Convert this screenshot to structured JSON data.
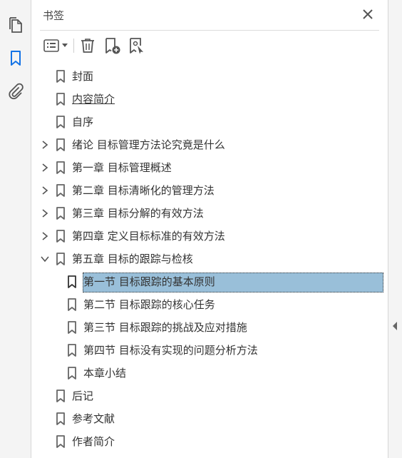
{
  "panel": {
    "title": "书签"
  },
  "toolbar": {
    "options": "options-menu",
    "delete": "delete",
    "new_bookmark": "new-bookmark",
    "new_from_structure": "new-from-structure"
  },
  "bookmarks": [
    {
      "label": "封面",
      "level": 0,
      "expandable": false
    },
    {
      "label": "内容简介",
      "level": 0,
      "expandable": false,
      "underlined": true
    },
    {
      "label": "自序",
      "level": 0,
      "expandable": false
    },
    {
      "label": "绪论 目标管理方法论究竟是什么",
      "level": 0,
      "expandable": true,
      "expanded": false
    },
    {
      "label": "第一章 目标管理概述",
      "level": 0,
      "expandable": true,
      "expanded": false
    },
    {
      "label": "第二章 目标清晰化的管理方法",
      "level": 0,
      "expandable": true,
      "expanded": false
    },
    {
      "label": "第三章 目标分解的有效方法",
      "level": 0,
      "expandable": true,
      "expanded": false
    },
    {
      "label": "第四章 定义目标标准的有效方法",
      "level": 0,
      "expandable": true,
      "expanded": false
    },
    {
      "label": "第五章 目标的跟踪与检核",
      "level": 0,
      "expandable": true,
      "expanded": true
    },
    {
      "label": "第一节 目标跟踪的基本原则",
      "level": 1,
      "expandable": false,
      "selected": true
    },
    {
      "label": "第二节 目标跟踪的核心任务",
      "level": 1,
      "expandable": false
    },
    {
      "label": "第三节 目标跟踪的挑战及应对措施",
      "level": 1,
      "expandable": false
    },
    {
      "label": "第四节 目标没有实现的问题分析方法",
      "level": 1,
      "expandable": false
    },
    {
      "label": "本章小结",
      "level": 1,
      "expandable": false
    },
    {
      "label": "后记",
      "level": 0,
      "expandable": false
    },
    {
      "label": "参考文献",
      "level": 0,
      "expandable": false
    },
    {
      "label": "作者简介",
      "level": 0,
      "expandable": false
    }
  ],
  "colors": {
    "selection": "#99bfd9",
    "icon": "#555555",
    "accent": "#1473e6"
  },
  "icons": {
    "rail": [
      "pages-icon",
      "bookmarks-icon",
      "attachments-icon"
    ]
  }
}
